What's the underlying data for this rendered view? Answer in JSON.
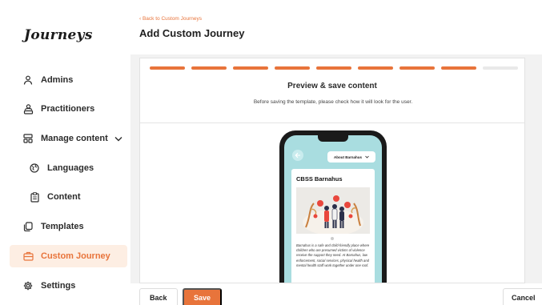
{
  "brand": {
    "logo": "Journeys",
    "accent": "#e8743b"
  },
  "sidebar": {
    "items": [
      {
        "label": "Admins",
        "icon": "user-icon"
      },
      {
        "label": "Practitioners",
        "icon": "users-icon"
      },
      {
        "label": "Manage content",
        "icon": "content-icon"
      },
      {
        "label": "Languages",
        "icon": "globe-icon"
      },
      {
        "label": "Content",
        "icon": "clipboard-icon"
      },
      {
        "label": "Templates",
        "icon": "copy-icon"
      },
      {
        "label": "Custom Journey",
        "icon": "briefcase-icon"
      },
      {
        "label": "Settings",
        "icon": "gear-icon"
      }
    ]
  },
  "header": {
    "back_link": "‹ Back to Custom Journeys",
    "title": "Add Custom Journey"
  },
  "progress": {
    "steps_total": 9,
    "steps_completed": 8
  },
  "card": {
    "title": "Preview & save content",
    "description": "Before saving the template, please check how it will look for the user."
  },
  "phone": {
    "back_icon": "arrow-left-icon",
    "select_value": "About Barnahus",
    "content_title": "CBSS Barnahus",
    "body_text": "Barnahus is a safe and child-friendly place where children who are presumed victims of violence receive the support they need. At Barnahus, law enforcement, social services, physical health and mental health staff work together under one roof."
  },
  "footer": {
    "back_label": "Back",
    "save_label": "Save",
    "cancel_label": "Cancel"
  }
}
